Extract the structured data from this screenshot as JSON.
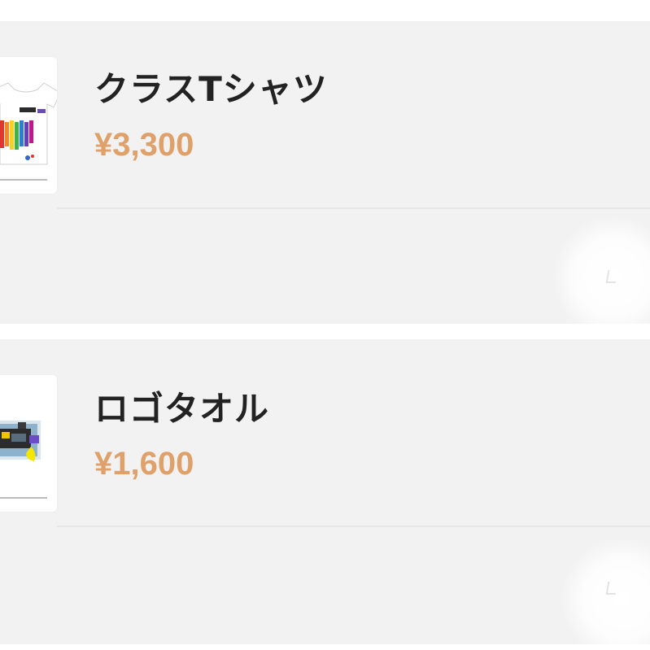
{
  "products": [
    {
      "name": "クラスTシャツ",
      "price": "¥3,300",
      "thumbnail_icon": "t-shirt-image"
    },
    {
      "name": "ロゴタオル",
      "price": "¥1,600",
      "thumbnail_icon": "towel-image"
    }
  ],
  "colors": {
    "price": "#e0a06a",
    "title": "#222222",
    "card_background": "#f2f2f2"
  }
}
